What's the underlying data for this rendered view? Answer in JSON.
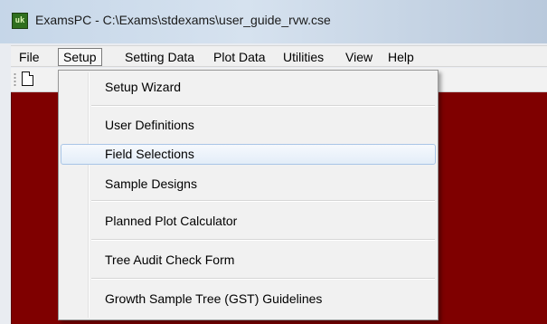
{
  "window": {
    "title": "ExamsPC - C:\\Exams\\stdexams\\user_guide_rvw.cse",
    "icon": "app-logo-icon"
  },
  "menubar": {
    "items": [
      {
        "label": "File"
      },
      {
        "label": "Setup",
        "active": true
      },
      {
        "label": "Setting Data"
      },
      {
        "label": "Plot Data"
      },
      {
        "label": "Utilities"
      },
      {
        "label": "View"
      },
      {
        "label": "Help"
      }
    ]
  },
  "toolbar": {
    "new_icon": "new-document-icon"
  },
  "setup_menu": {
    "items": [
      {
        "label": "Setup Wizard"
      },
      {
        "label": "User Definitions"
      },
      {
        "label": "Field Selections",
        "highlighted": true
      },
      {
        "label": "Sample Designs"
      },
      {
        "label": "Planned Plot Calculator"
      },
      {
        "label": "Tree Audit Check Form"
      },
      {
        "label": "Growth Sample Tree (GST) Guidelines"
      }
    ]
  },
  "colors": {
    "client_background": "#7f0000",
    "highlight": "#dde8f6"
  }
}
